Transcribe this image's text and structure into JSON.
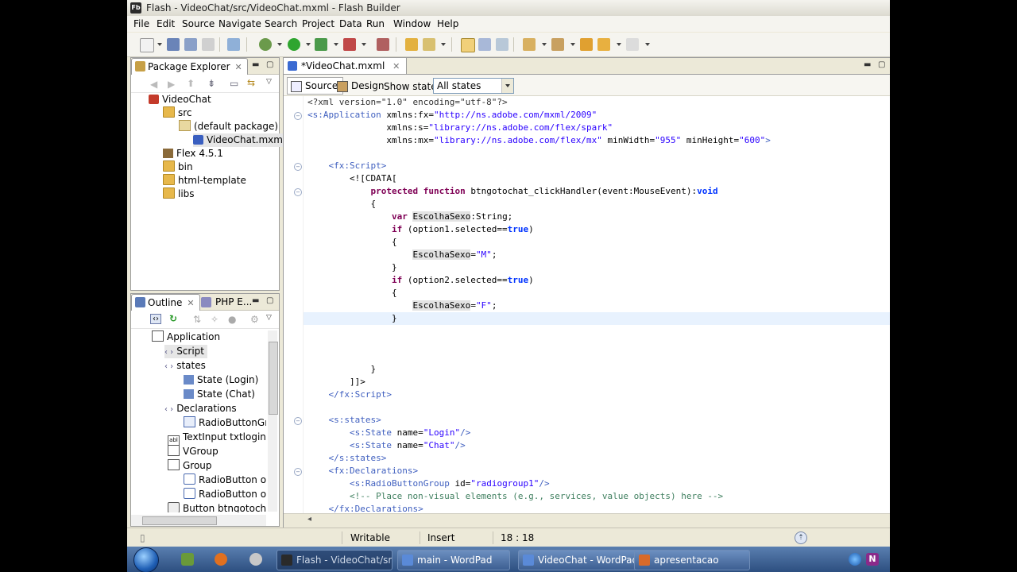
{
  "window": {
    "title": "Flash - VideoChat/src/VideoChat.mxml - Flash Builder",
    "logo_text": "Fb"
  },
  "menu": [
    "File",
    "Edit",
    "Source",
    "Navigate",
    "Search",
    "Project",
    "Data",
    "Run",
    "Window",
    "Help"
  ],
  "package_explorer": {
    "tab_label": "Package Explorer",
    "tree": [
      {
        "label": "VideoChat",
        "icon": "flex-project-icon"
      },
      {
        "label": "src",
        "icon": "source-folder-icon"
      },
      {
        "label": "(default package)",
        "icon": "package-icon"
      },
      {
        "label": "VideoChat.mxml",
        "icon": "mxml-file-icon"
      },
      {
        "label": "Flex 4.5.1",
        "icon": "library-icon"
      },
      {
        "label": "bin",
        "icon": "folder-icon"
      },
      {
        "label": "html-template",
        "icon": "folder-icon"
      },
      {
        "label": "libs",
        "icon": "folder-icon"
      }
    ]
  },
  "outline": {
    "tab_label": "Outline",
    "tab2_label": "PHP E...",
    "tree": [
      {
        "label": "Application"
      },
      {
        "label": "Script"
      },
      {
        "label": "states"
      },
      {
        "label": "State (Login)"
      },
      {
        "label": "State (Chat)"
      },
      {
        "label": "Declarations"
      },
      {
        "label": "RadioButtonGrou"
      },
      {
        "label": "TextInput txtlogin"
      },
      {
        "label": "VGroup"
      },
      {
        "label": "Group"
      },
      {
        "label": "RadioButton opt"
      },
      {
        "label": "RadioButton opt"
      },
      {
        "label": "Button btngotochat"
      }
    ]
  },
  "editor": {
    "tab_label": "*VideoChat.mxml",
    "source_label": "Source",
    "design_label": "Design",
    "show_state_label": "Show state:",
    "show_state_value": "All states",
    "lines": [
      "<?xml version=\"1.0\" encoding=\"utf-8\"?>",
      "<s:Application xmlns:fx=\"http://ns.adobe.com/mxml/2009\"",
      "               xmlns:s=\"library://ns.adobe.com/flex/spark\"",
      "               xmlns:mx=\"library://ns.adobe.com/flex/mx\" minWidth=\"955\" minHeight=\"600\">",
      "",
      "    <fx:Script>",
      "        <![CDATA[",
      "            protected function btngotochat_clickHandler(event:MouseEvent):void",
      "            {",
      "                var EscolhaSexo:String;",
      "                if (option1.selected==true)",
      "                {",
      "                    EscolhaSexo=\"M\";",
      "                }",
      "                if (option2.selected==true)",
      "                {",
      "                    EscolhaSexo=\"F\";",
      "                }",
      "",
      "",
      "",
      "            }",
      "        ]]>",
      "    </fx:Script>",
      "",
      "    <s:states>",
      "        <s:State name=\"Login\"/>",
      "        <s:State name=\"Chat\"/>",
      "    </s:states>",
      "    <fx:Declarations>",
      "        <s:RadioButtonGroup id=\"radiogroup1\"/>",
      "        <!-- Place non-visual elements (e.g., services, value objects) here -->",
      "    </fx:Declarations>"
    ]
  },
  "status": {
    "mode": "Writable",
    "insert": "Insert",
    "position": "18 : 18"
  },
  "taskbar": {
    "buttons": [
      {
        "label": "Flash - VideoChat/sr...",
        "icon": "flash-builder-icon"
      },
      {
        "label": "main - WordPad",
        "icon": "wordpad-icon"
      },
      {
        "label": "VideoChat - WordPad",
        "icon": "wordpad-icon"
      },
      {
        "label": "apresentacao",
        "icon": "powerpoint-icon"
      }
    ]
  },
  "colors": {
    "tag": "#3f5fbf",
    "string": "#2a00ff",
    "keyword": "#7f0055",
    "comment": "#3f7f5f",
    "current_line": "#e8f2fe"
  }
}
